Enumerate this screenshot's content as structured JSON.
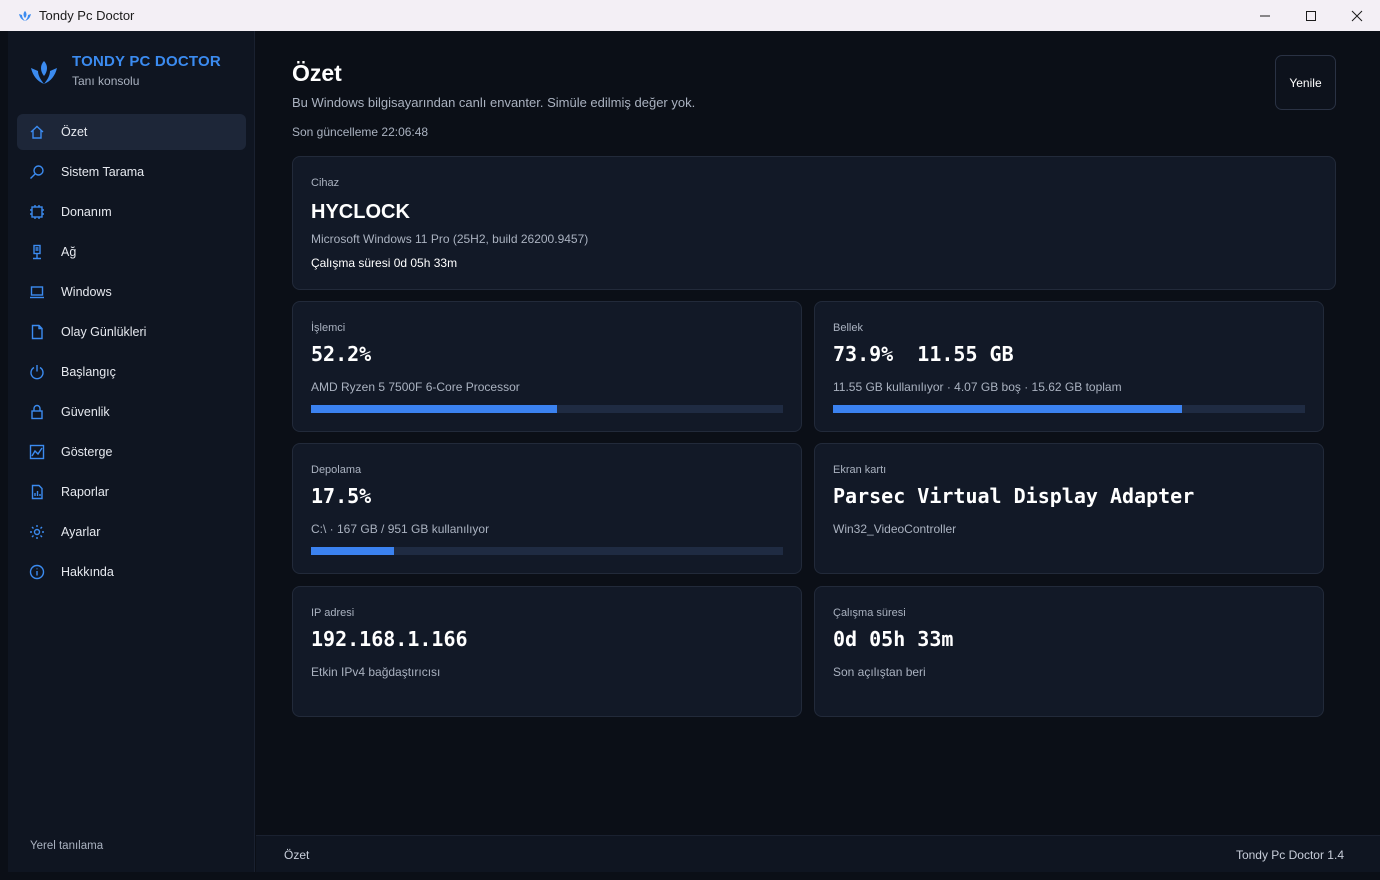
{
  "window": {
    "title": "Tondy Pc Doctor",
    "controls": [
      "minimize-icon",
      "maximize-icon",
      "close-icon"
    ]
  },
  "brand": {
    "name": "TONDY PC DOCTOR",
    "subtitle": "Tanı konsolu",
    "accent": "#3b8bf0"
  },
  "sidebar": {
    "items": [
      {
        "label": "Özet",
        "icon": "home-icon",
        "active": true
      },
      {
        "label": "Sistem Tarama",
        "icon": "search-icon"
      },
      {
        "label": "Donanım",
        "icon": "chip-icon"
      },
      {
        "label": "Ağ",
        "icon": "network-icon"
      },
      {
        "label": "Windows",
        "icon": "laptop-icon"
      },
      {
        "label": "Olay Günlükleri",
        "icon": "document-icon"
      },
      {
        "label": "Başlangıç",
        "icon": "power-icon"
      },
      {
        "label": "Güvenlik",
        "icon": "lock-icon"
      },
      {
        "label": "Gösterge",
        "icon": "chart-icon"
      },
      {
        "label": "Raporlar",
        "icon": "report-icon"
      },
      {
        "label": "Ayarlar",
        "icon": "gear-icon"
      },
      {
        "label": "Hakkında",
        "icon": "info-icon"
      }
    ],
    "footer": "Yerel tanılama"
  },
  "header": {
    "title": "Özet",
    "description": "Bu Windows bilgisayarından canlı envanter. Simüle edilmiş değer yok.",
    "updated": "Son güncelleme 22:06:48",
    "refresh_label": "Yenile"
  },
  "device": {
    "label": "Cihaz",
    "name": "HYCLOCK",
    "os": "Microsoft Windows 11 Pro (25H2, build 26200.9457)",
    "uptime": "Çalışma süresi 0d 05h 33m"
  },
  "cards": {
    "cpu": {
      "label": "İşlemci",
      "value": "52.2%",
      "detail": "AMD Ryzen 5 7500F 6-Core Processor",
      "progress": 0.522
    },
    "memory": {
      "label": "Bellek",
      "value": "73.9%  11.55 GB",
      "detail": "11.55 GB kullanılıyor · 4.07 GB boş · 15.62 GB toplam",
      "progress": 0.739
    },
    "storage": {
      "label": "Depolama",
      "value": "17.5%",
      "detail": "C:\\ · 167 GB / 951 GB kullanılıyor",
      "progress": 0.175
    },
    "gpu": {
      "label": "Ekran kartı",
      "value": "Parsec Virtual Display Adapter",
      "detail": "Win32_VideoController"
    },
    "ip": {
      "label": "IP adresi",
      "value": "192.168.1.166",
      "detail": "Etkin IPv4 bağdaştırıcısı"
    },
    "uptime": {
      "label": "Çalışma süresi",
      "value": "0d 05h 33m",
      "detail": "Son açılıştan beri"
    }
  },
  "statusbar": {
    "left": "Özet",
    "right": "Tondy Pc Doctor 1.4"
  }
}
